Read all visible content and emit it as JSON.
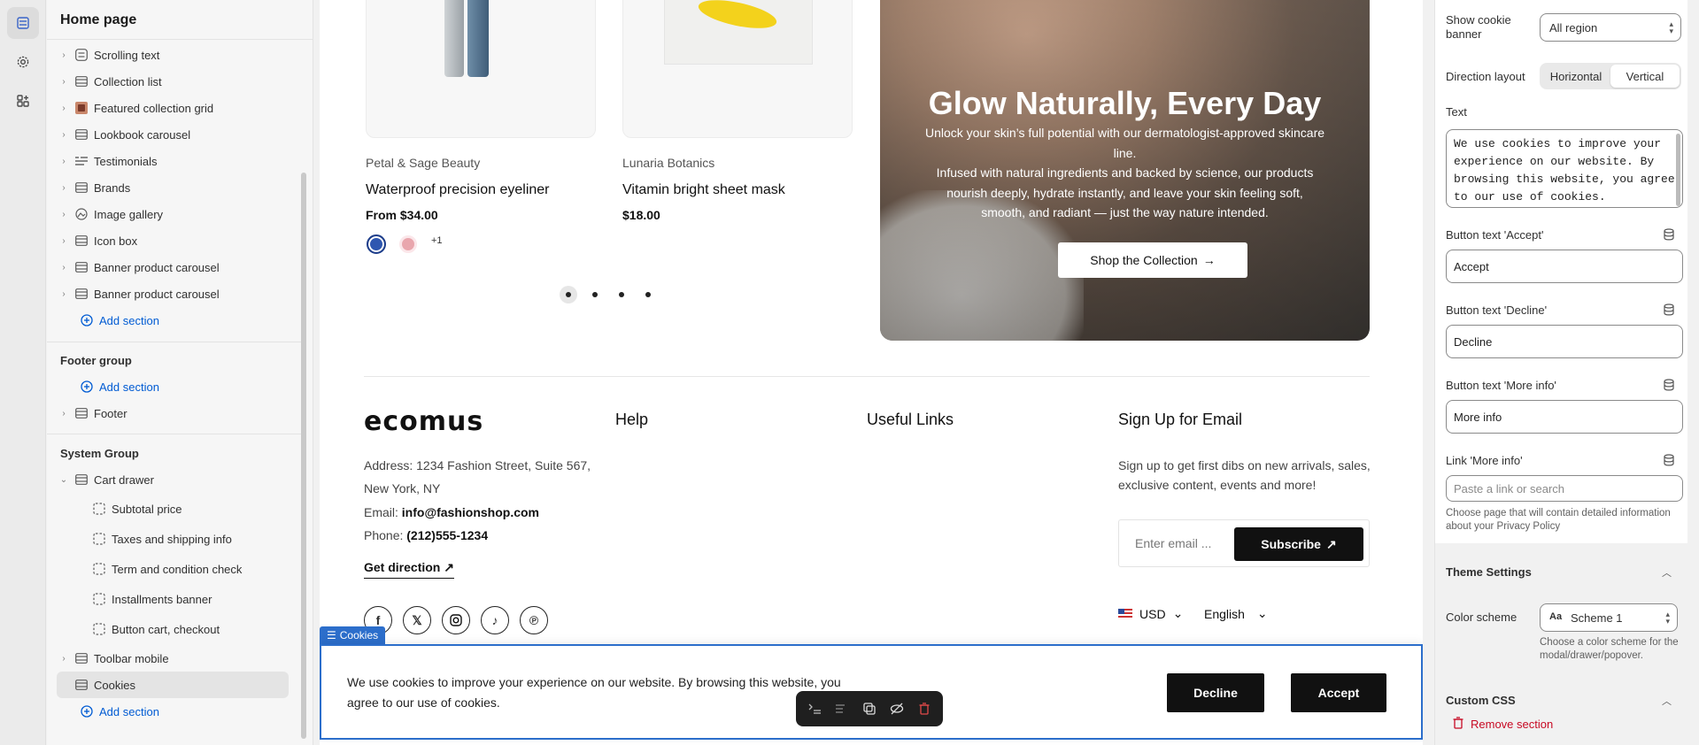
{
  "sidebar": {
    "title": "Home page",
    "sections": [
      {
        "label": "Scrolling text",
        "icon": "text-lines-icon"
      },
      {
        "label": "Collection list",
        "icon": "list-icon"
      },
      {
        "label": "Featured collection grid",
        "icon": "image-thumb-icon"
      },
      {
        "label": "Lookbook carousel",
        "icon": "list-icon"
      },
      {
        "label": "Testimonials",
        "icon": "quote-lines-icon"
      },
      {
        "label": "Brands",
        "icon": "list-icon"
      },
      {
        "label": "Image gallery",
        "icon": "image-icon"
      },
      {
        "label": "Icon box",
        "icon": "list-icon"
      },
      {
        "label": "Banner product carousel",
        "icon": "list-icon"
      },
      {
        "label": "Banner product carousel",
        "icon": "list-icon"
      }
    ],
    "add_section": "Add section",
    "footer_group": {
      "title": "Footer group",
      "add_section": "Add section",
      "items": [
        {
          "label": "Footer"
        }
      ]
    },
    "system_group": {
      "title": "System Group",
      "cart_drawer": "Cart drawer",
      "cart_children": [
        "Subtotal price",
        "Taxes and shipping info",
        "Term and condition check",
        "Installments banner",
        "Button cart, checkout"
      ],
      "toolbar_mobile": "Toolbar mobile",
      "cookies": "Cookies",
      "add_section": "Add section"
    }
  },
  "preview": {
    "products": [
      {
        "brand": "Petal & Sage Beauty",
        "name": "Waterproof precision eyeliner",
        "price": "From $34.00",
        "more_swatches": "+1"
      },
      {
        "brand": "Lunaria Botanics",
        "name": "Vitamin bright sheet mask",
        "price": "$18.00"
      }
    ],
    "hero": {
      "title": "Glow Naturally, Every Day",
      "line1": "Unlock your skin’s full potential with our dermatologist-approved skincare line.",
      "line2": "Infused with natural ingredients and backed by science, our products nourish deeply, hydrate instantly, and leave your skin feeling soft, smooth, and radiant — just the way nature intended.",
      "button": "Shop the Collection"
    },
    "footer": {
      "logo": "ecomus",
      "help": "Help",
      "useful_links": "Useful Links",
      "signup_title": "Sign Up for Email",
      "address_l1": "Address: 1234 Fashion Street, Suite 567,",
      "address_l2": "New York, NY",
      "email_label": "Email:",
      "email": "info@fashionshop.com",
      "phone_label": "Phone:",
      "phone": "(212)555-1234",
      "get_direction": "Get direction",
      "signup_text": "Sign up to get first dibs on new arrivals, sales, exclusive content, events and more!",
      "email_placeholder": "Enter email ...",
      "subscribe": "Subscribe",
      "currency": "USD",
      "language": "English",
      "socials": [
        "facebook-icon",
        "x-icon",
        "instagram-icon",
        "tiktok-icon",
        "pinterest-icon"
      ]
    },
    "cookie_bar": {
      "tag": "Cookies",
      "text": "We use cookies to improve your experience on our website. By browsing this website, you agree to our use of cookies.",
      "decline": "Decline",
      "accept": "Accept"
    }
  },
  "settings": {
    "show_cookie_banner_label": "Show cookie banner",
    "show_cookie_banner_value": "All region",
    "direction_label": "Direction layout",
    "direction_options": [
      "Horizontal",
      "Vertical"
    ],
    "direction_selected": "Vertical",
    "text_label": "Text",
    "text_value": "We use cookies to improve your experience on our website. By browsing this website, you agree to our use of cookies.",
    "accept_label": "Button text 'Accept'",
    "accept_value": "Accept",
    "decline_label": "Button text 'Decline'",
    "decline_value": "Decline",
    "more_info_label": "Button text 'More info'",
    "more_info_value": "More info",
    "link_label": "Link 'More info'",
    "link_placeholder": "Paste a link or search",
    "link_help": "Choose page that will contain detailed information about your Privacy Policy",
    "theme_settings": "Theme Settings",
    "color_scheme_label": "Color scheme",
    "color_scheme_value": "Scheme 1",
    "color_scheme_help": "Choose a color scheme for the modal/drawer/popover.",
    "custom_css": "Custom CSS",
    "remove_section": "Remove section"
  },
  "colors": {
    "accent": "#2c6ecb",
    "link": "#005bd3",
    "danger": "#c70a24"
  }
}
